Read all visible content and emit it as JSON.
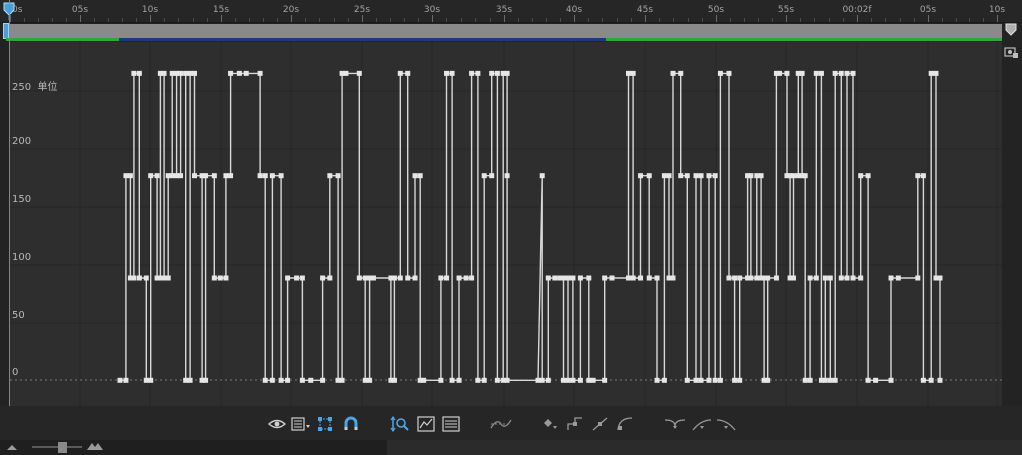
{
  "ruler": {
    "ticks": [
      "0s",
      "05s",
      "10s",
      "15s",
      "20s",
      "25s",
      "30s",
      "35s",
      "40s",
      "45s",
      "50s",
      "55s",
      "00:02f",
      "05s",
      "10s"
    ]
  },
  "y_axis": {
    "labels": [
      "250",
      "200",
      "150",
      "100",
      "50",
      "0"
    ],
    "unit": "单位"
  },
  "colors": {
    "accent": "#3f9bd6",
    "work_area": "#2ca93a",
    "graph_bg": "#2e2e2e",
    "curve": "#d8d8d8"
  },
  "toolbar": {
    "icons": [
      "eye-icon",
      "graph-type-icon",
      "transform-box-icon",
      "snap-icon",
      "fit-selection-icon",
      "fit-all-icon",
      "graph-editor-icon",
      "separate-dimensions-icon",
      "edit-keyframe-icon",
      "hold-keyframe-icon",
      "linear-keyframe-icon",
      "auto-bezier-keyframe-icon",
      "easy-ease-icon",
      "easy-ease-in-icon",
      "easy-ease-out-icon"
    ]
  },
  "chart_data": {
    "type": "line",
    "title": "",
    "xlabel": "",
    "ylabel": "单位",
    "ylim": [
      -5,
      280
    ],
    "step_levels": [
      0,
      90,
      180,
      270
    ],
    "series": [
      {
        "name": "",
        "keyframe_count": 280
      }
    ]
  }
}
